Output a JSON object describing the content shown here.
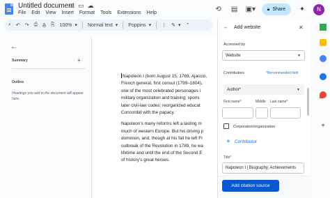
{
  "app": {
    "doc_title": "Untitled document",
    "menu": [
      "File",
      "Edit",
      "View",
      "Insert",
      "Format",
      "Tools",
      "Extensions",
      "Help"
    ],
    "share_label": "Share",
    "avatar_letter": "N"
  },
  "toolbar": {
    "zoom": "100%",
    "style": "Normal text",
    "font": "Poppins"
  },
  "outline": {
    "summary_label": "Summary",
    "outline_label": "Outline",
    "hint": "Headings you add to the document will appear here."
  },
  "document": {
    "paragraphs": [
      [
        "Napoleon I (born August 15, 1769, Ajaccio,",
        "French general, first consul (1799–1804),",
        "one of the most celebrated personages i",
        "military organization and training; spons",
        "later civil-law codes; reorganized educat",
        "Concordat with the papacy."
      ],
      [
        "Napoleon’s many reforms left a lasting m",
        "much of western Europe. But his driving p",
        "dominion, and, though at his fall he left Fr",
        "outbreak of the Revolution in 1789, he wa",
        "lifetime and until the end of the Second E",
        "of history’s great heroes."
      ]
    ]
  },
  "citation_panel": {
    "title": "Add website",
    "accessed_by_label": "Accessed by",
    "accessed_by_value": "Website",
    "contributors_label": "Contributors",
    "recommended": "*Recommended field",
    "role_value": "Author*",
    "first_name_label": "First name*",
    "middle_label": "Middle",
    "last_name_label": "Last name*",
    "org_label": "Corporation/organization",
    "add_contributor": "Contributor",
    "title_label": "Title*",
    "title_value": "Napoleon I | Biography, Achievements",
    "add_button": "Add citation source"
  }
}
